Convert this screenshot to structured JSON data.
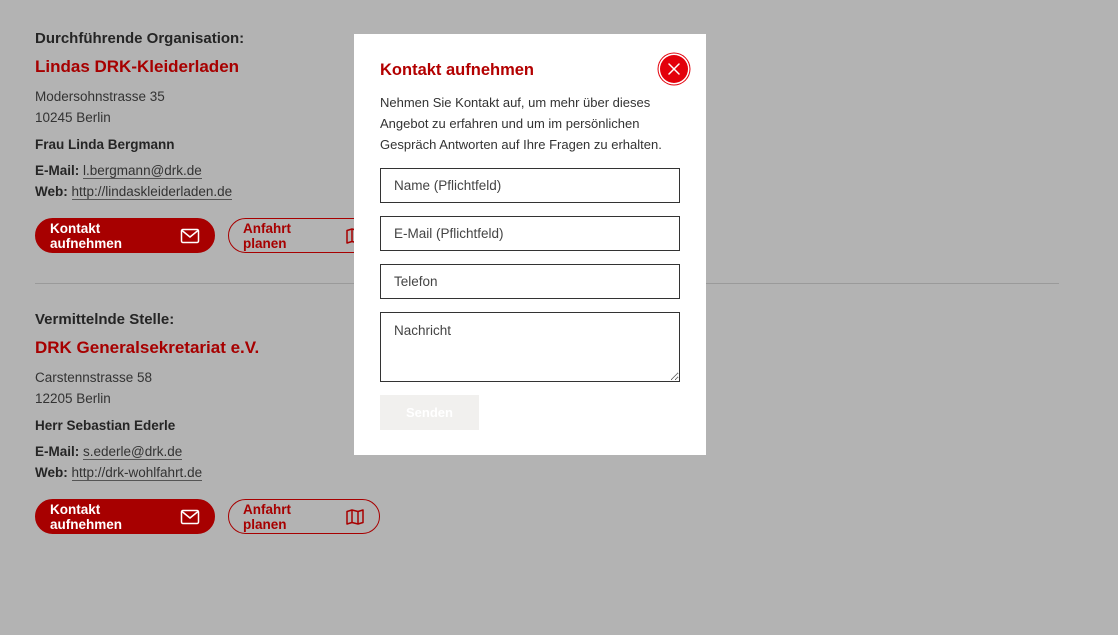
{
  "sections": [
    {
      "label": "Durchführende Organisation:",
      "org_name": "Lindas DRK-Kleiderladen",
      "street": "Modersohnstrasse 35",
      "city": "10245 Berlin",
      "person": "Frau Linda Bergmann",
      "email_label": "E-Mail:",
      "email": "l.bergmann@drk.de",
      "web_label": "Web:",
      "web": "http://lindaskleiderladen.de",
      "contact_button": "Kontakt aufnehmen",
      "route_button": "Anfahrt planen"
    },
    {
      "label": "Vermittelnde Stelle:",
      "org_name": "DRK Generalsekretariat e.V.",
      "street": "Carstennstrasse 58",
      "city": "12205 Berlin",
      "person": "Herr Sebastian Ederle",
      "email_label": "E-Mail:",
      "email": "s.ederle@drk.de",
      "web_label": "Web:",
      "web": "http://drk-wohlfahrt.de",
      "contact_button": "Kontakt aufnehmen",
      "route_button": "Anfahrt planen"
    }
  ],
  "modal": {
    "title": "Kontakt aufnehmen",
    "description": "Nehmen Sie Kontakt auf, um mehr über dieses Angebot zu erfahren und um im persönlichen Gespräch Antworten auf Ihre Fragen zu erhalten.",
    "fields": {
      "name_placeholder": "Name (Pflichtfeld)",
      "email_placeholder": "E-Mail (Pflichtfeld)",
      "phone_placeholder": "Telefon",
      "message_placeholder": "Nachricht"
    },
    "submit_label": "Senden"
  },
  "colors": {
    "brand_red": "#a70000",
    "close_red": "#e3000b",
    "overlay": "#b3b3b3"
  },
  "icons": {
    "close": "close-icon",
    "mail": "mail-icon",
    "map": "map-icon"
  }
}
